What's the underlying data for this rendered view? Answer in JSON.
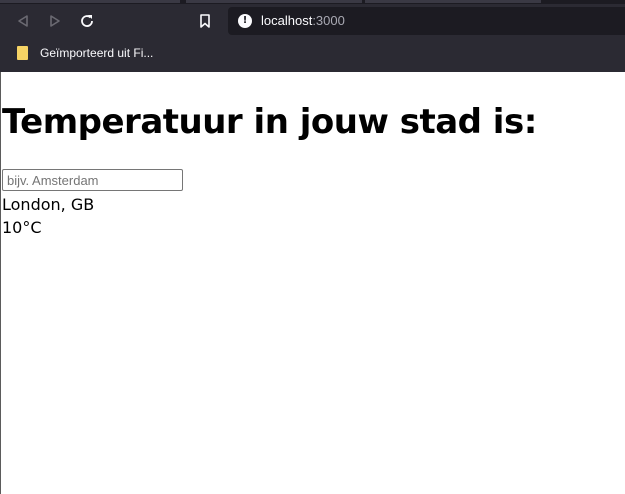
{
  "browser": {
    "url_host": "localhost",
    "url_port": ":3000",
    "bookmark_folder_label": "Geïmporteerd uit Fi...",
    "icons": [
      "back-icon",
      "forward-icon",
      "reload-icon",
      "bookmark-icon",
      "site-info-icon",
      "folder-icon"
    ]
  },
  "page": {
    "title": "Temperatuur in jouw stad is:",
    "search": {
      "placeholder": "bijv. Amsterdam",
      "value": ""
    },
    "result": {
      "location": "London, GB",
      "temperature": "10°C"
    }
  },
  "colors": {
    "chrome_bg": "#2b2a33",
    "urlbar_bg": "#1c1b22",
    "page_bg": "#ffffff",
    "text": "#000000"
  }
}
